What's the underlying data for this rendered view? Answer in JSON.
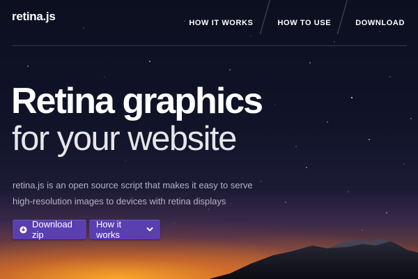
{
  "brand": {
    "logo_text": "retina.js"
  },
  "nav": {
    "items": [
      {
        "label": "HOW IT WORKS"
      },
      {
        "label": "HOW TO USE"
      },
      {
        "label": "DOWNLOAD"
      }
    ]
  },
  "hero": {
    "headline": "Retina graphics",
    "subheadline": "for your website",
    "description_line1": "retina.js is an open source script that makes it easy to serve",
    "description_line2": "high-resolution images to devices with retina displays"
  },
  "buttons": {
    "download_label": "Download zip",
    "download_icon": "download-circle-icon",
    "how_label": "How it works",
    "how_icon": "chevron-down-icon"
  },
  "colors": {
    "button_bg": "#5a3fb0",
    "text_primary": "#ffffff",
    "text_muted": "#b6b3c4"
  }
}
